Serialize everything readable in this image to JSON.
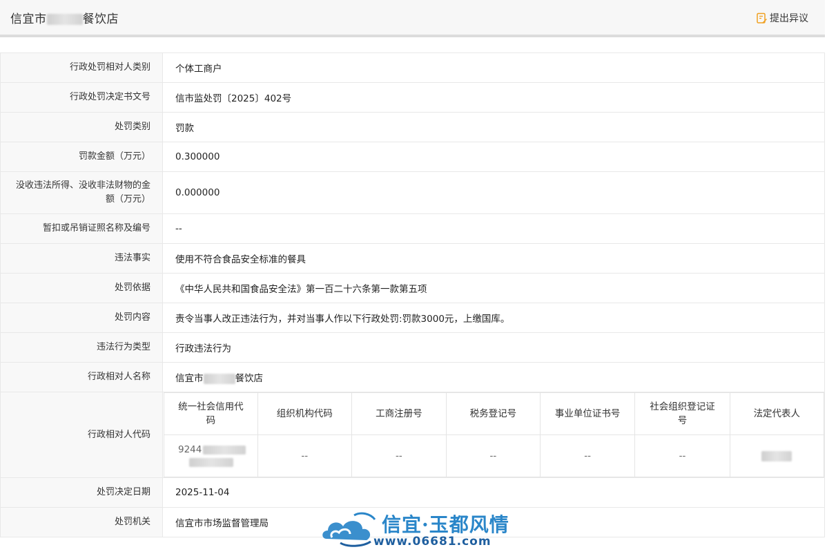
{
  "header": {
    "title_prefix": "信宜市",
    "title_suffix": "餐饮店",
    "objection_label": "提出异议"
  },
  "rows": [
    {
      "label": "行政处罚相对人类别",
      "value": "个体工商户"
    },
    {
      "label": "行政处罚决定书文号",
      "value": "信市监处罚〔2025〕402号"
    },
    {
      "label": "处罚类别",
      "value": "罚款"
    },
    {
      "label": "罚款金额（万元）",
      "value": "0.300000"
    },
    {
      "label": "没收违法所得、没收非法财物的金额（万元）",
      "value": "0.000000"
    },
    {
      "label": "暂扣或吊销证照名称及编号",
      "value": "--"
    },
    {
      "label": "违法事实",
      "value": "使用不符合食品安全标准的餐具"
    },
    {
      "label": "处罚依据",
      "value": "《中华人民共和国食品安全法》第一百二十六条第一款第五项"
    },
    {
      "label": "处罚内容",
      "value": "责令当事人改正违法行为，并对当事人作以下行政处罚:罚款3000元，上缴国库。"
    },
    {
      "label": "违法行为类型",
      "value": "行政违法行为"
    }
  ],
  "party_name": {
    "label": "行政相对人名称",
    "value_prefix": "信宜市",
    "value_suffix": "餐饮店"
  },
  "party_code": {
    "label": "行政相对人代码",
    "headers": [
      "统一社会信用代码",
      "组织机构代码",
      "工商注册号",
      "税务登记号",
      "事业单位证书号",
      "社会组织登记证号",
      "法定代表人"
    ],
    "credit_code_visible": "9244",
    "cells": [
      "--",
      "--",
      "--",
      "--",
      "--"
    ]
  },
  "decision_date": {
    "label": "处罚决定日期",
    "value": "2025-11-04"
  },
  "authority": {
    "label": "处罚机关",
    "value": "信宜市市场监督管理局"
  },
  "watermark": {
    "name": "信宜·玉都风情",
    "url": "www.06681.com"
  },
  "colors": {
    "label_bg": "#f8f8f8",
    "border": "#e8e8e8",
    "objection_icon": "#f0a020",
    "watermark_blue": "#2a86c9"
  }
}
